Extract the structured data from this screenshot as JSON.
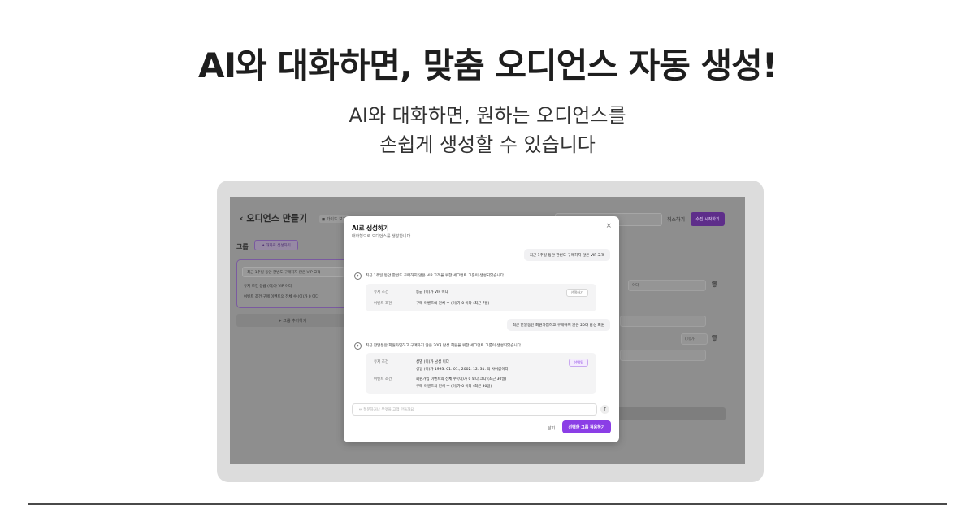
{
  "headline": "AI와 대화하면, 맞춤 오디언스 자동 생성!",
  "subline_1": "AI와 대화하면, 원하는 오디언스를",
  "subline_2": "손쉽게 생성할 수 있습니다",
  "background_app": {
    "back_arrow": "‹",
    "title": "오디언스 만들기",
    "guide_badge": "◼ 가이드 보기",
    "cancel_label": "취소하기",
    "primary_label": "수집 시작하기",
    "group_label": "그룹",
    "ai_button": "✦ 대화로 생성하기",
    "card_title": "최근 1주일 동안 한번도 구매하지 않은 VIP 고객",
    "card_row1": "유저 조건     등급 (이)가 VIP 이다",
    "card_row2": "이벤트 조건   구매 이벤트의 전체 수 (이)가 0 이다",
    "add_group": "+  그룹 추가하기",
    "right_field_1": "이다",
    "right_field_2": "(이)가"
  },
  "modal": {
    "title": "AI로 생성하기",
    "subtitle": "대화형으로 오디언스를 생성합니다.",
    "close_icon": "×",
    "user_msg_1": "최근 1주일 동안 한번도 구매하지 않은 VIP 고객",
    "ai_msg_1": "최근 1주일 동안 한번도 구매하지 않은 VIP 고객을 위한 세그먼트 그룹이 생성되었습니다.",
    "card1": {
      "user_label": "유저 조건",
      "user_value": "등급 (이)가 VIP 이다",
      "event_label": "이벤트 조건",
      "event_value": "구매 이벤트의 전체 수 (이)가 0 이다 (최근 7일)",
      "select_label": "선택하기"
    },
    "user_msg_2": "최근 한달동안 회원가입하고 구매하지 않은 20대 남성 회원",
    "ai_msg_2": "최근 한달동안 회원가입하고 구매하지 않은 20대 남성 회원을 위한 세그먼트 그룹이 생성되었습니다.",
    "card2": {
      "user_label": "유저 조건",
      "user_value_1": "성별 (이)가 남성 이다",
      "user_value_2": "생일 (이)가 1993. 01. 01., 2002. 12. 31. 의 사이값이다",
      "event_label": "이벤트 조건",
      "event_value_1": "회원가입 이벤트의 전체 수 (이)가 0 보다 크다 (최근 30일)",
      "event_value_2": "구매 이벤트의 전체 수 (이)가 0 이다 (최근 30일)",
      "select_label": "선택됨"
    },
    "input_placeholder": "✏ 질문하거나 무엇을 고객 만들까요",
    "send_icon": "↑",
    "close_label": "닫기",
    "apply_label": "선택한 그룹 적용하기"
  }
}
